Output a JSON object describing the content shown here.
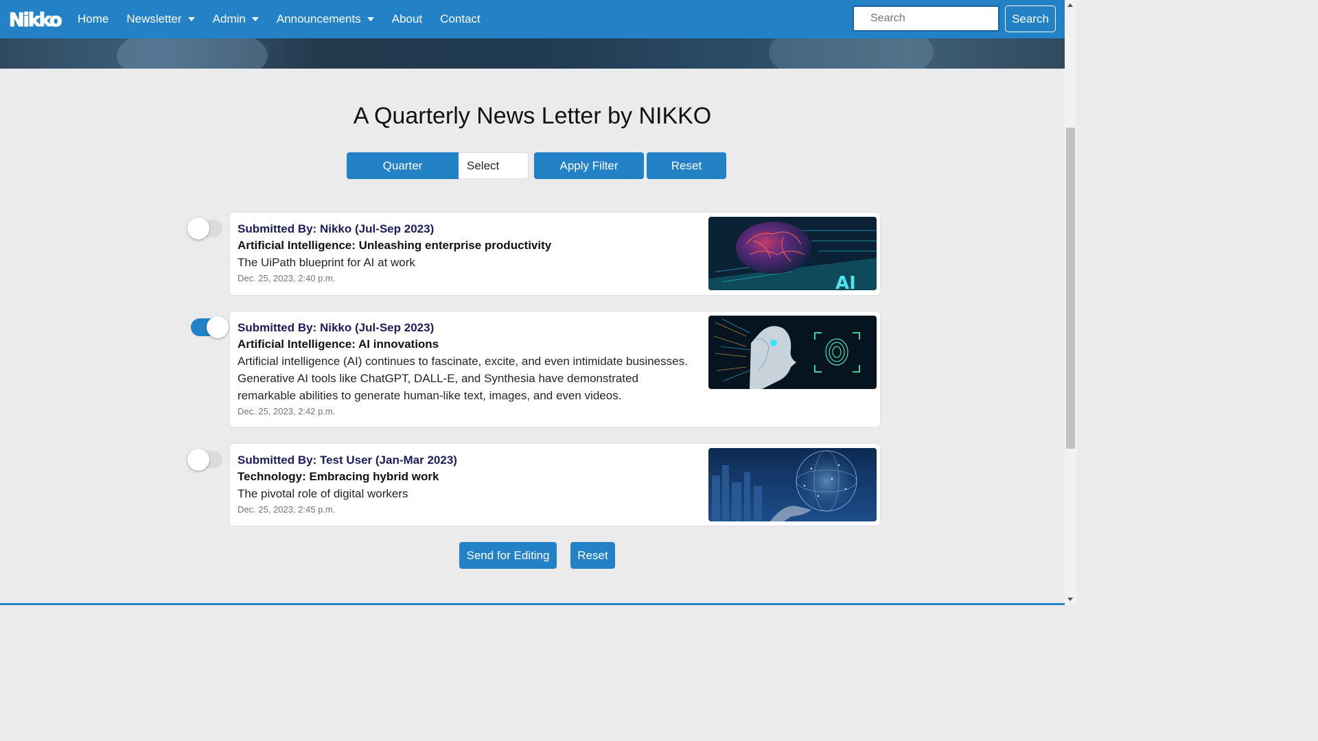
{
  "nav": {
    "logo_text": "Nikko",
    "items": [
      {
        "label": "Home",
        "dropdown": false
      },
      {
        "label": "Newsletter",
        "dropdown": true
      },
      {
        "label": "Admin",
        "dropdown": true
      },
      {
        "label": "Announcements",
        "dropdown": true
      },
      {
        "label": "About",
        "dropdown": false
      },
      {
        "label": "Contact",
        "dropdown": false
      }
    ],
    "search_placeholder": "Search",
    "search_button": "Search"
  },
  "page": {
    "title": "A Quarterly News Letter by NIKKO"
  },
  "filter": {
    "quarter_label": "Quarter",
    "select_value": "Select",
    "apply_label": "Apply Filter",
    "reset_label": "Reset"
  },
  "newsletters": [
    {
      "submitter": "Submitted By: Nikko (Jul-Sep 2023)",
      "heading": "Artificial Intelligence: Unleashing enterprise productivity",
      "body": "The UiPath blueprint for AI at work",
      "date": "Dec. 25, 2023, 2:40 p.m.",
      "selected": false,
      "image": "ai-brain-circuit-image"
    },
    {
      "submitter": "Submitted By: Nikko (Jul-Sep 2023)",
      "heading": "Artificial Intelligence: AI innovations",
      "body": "Artificial intelligence (AI) continues to fascinate, excite, and even intimidate businesses. Generative AI tools like ChatGPT, DALL-E, and Synthesia have demonstrated remarkable abilities to generate human-like text, images, and even videos.",
      "date": "Dec. 25, 2023, 2:42 p.m.",
      "selected": true,
      "image": "robot-fingerprint-image"
    },
    {
      "submitter": "Submitted By: Test User (Jan-Mar 2023)",
      "heading": "Technology: Embracing hybrid work",
      "body": "The pivotal role of digital workers",
      "date": "Dec. 25, 2023, 2:45 p.m.",
      "selected": false,
      "image": "digital-globe-hand-image"
    }
  ],
  "actions": {
    "send_label": "Send for Editing",
    "reset_label": "Reset"
  },
  "colors": {
    "primary": "#2382c6",
    "background": "#ebebeb",
    "submitter_text": "#1b1b5e"
  }
}
